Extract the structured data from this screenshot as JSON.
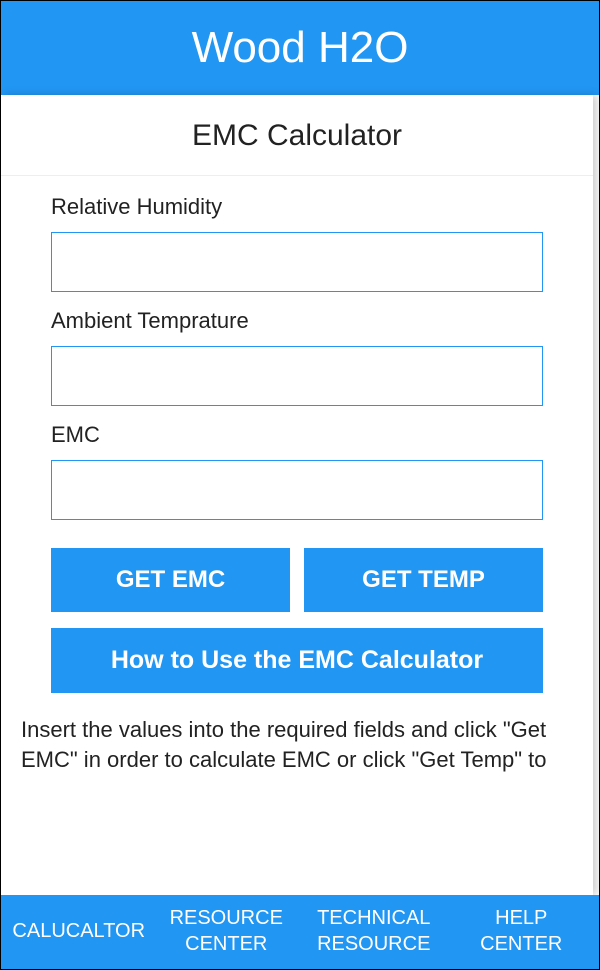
{
  "header": {
    "title": "Wood H2O"
  },
  "page": {
    "title": "EMC Calculator"
  },
  "fields": {
    "relative_humidity": {
      "label": "Relative Humidity",
      "value": ""
    },
    "ambient_temperature": {
      "label": "Ambient Temprature",
      "value": ""
    },
    "emc": {
      "label": "EMC",
      "value": ""
    }
  },
  "buttons": {
    "get_emc": "GET EMC",
    "get_temp": "GET TEMP",
    "how_to": "How to Use the EMC Calculator"
  },
  "instructions": "Insert the values into the required fields and click \"Get EMC\" in order to calculate EMC or click \"Get Temp\" to",
  "nav": {
    "items": [
      {
        "line1": "CALUCALTOR",
        "line2": ""
      },
      {
        "line1": "RESOURCE",
        "line2": "CENTER"
      },
      {
        "line1": "TECHNICAL",
        "line2": "RESOURCE"
      },
      {
        "line1": "HELP",
        "line2": "CENTER"
      }
    ]
  }
}
